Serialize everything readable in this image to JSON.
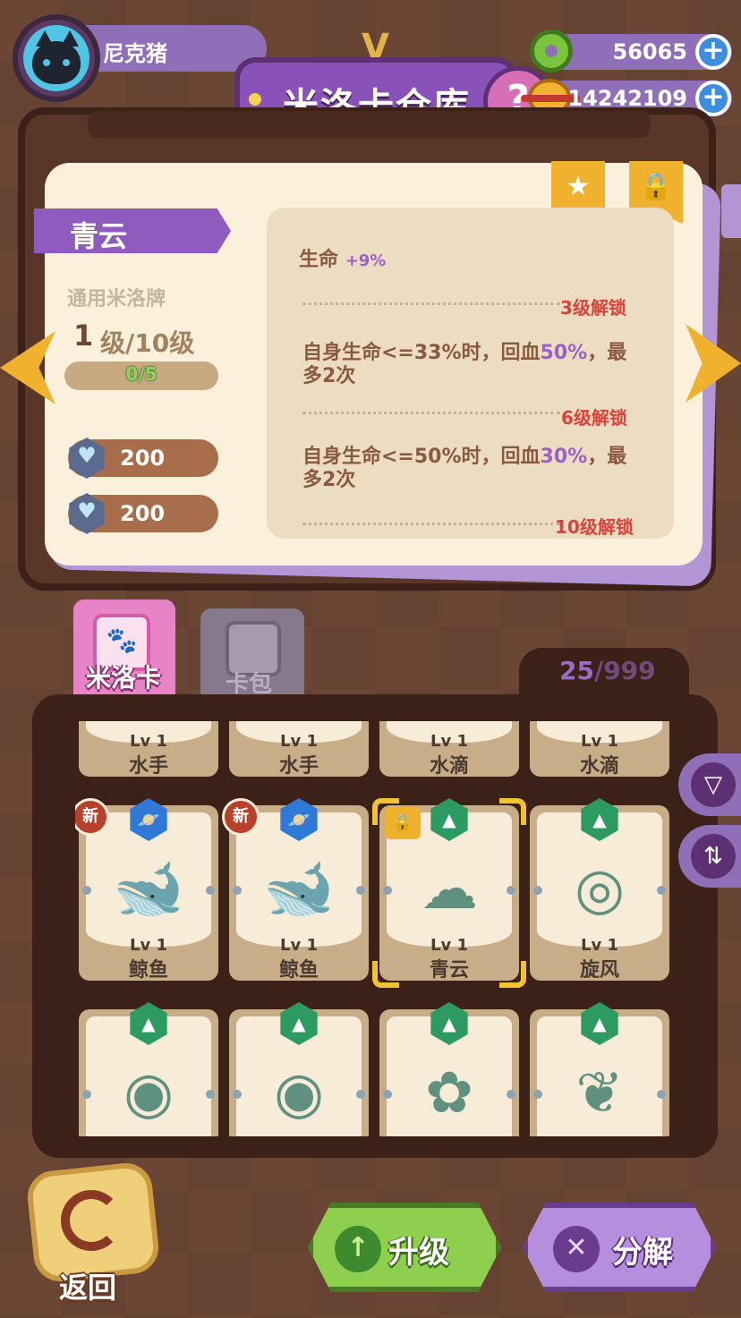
{
  "player": {
    "name": "尼克猪"
  },
  "header": {
    "title": "米洛卡仓库",
    "help": "?"
  },
  "currency": [
    {
      "icon": "donut-coin-icon",
      "value": "56065"
    },
    {
      "icon": "planet-coin-icon",
      "value": "14242109"
    }
  ],
  "detail": {
    "name": "青云",
    "card_type": "通用米洛牌",
    "level_current": "1",
    "level_text": "级/10级",
    "progress": "0/5",
    "progress_fraction": 0,
    "costs": [
      {
        "icon": "heart-gem-icon",
        "value": "200"
      },
      {
        "icon": "heart-gem-icon",
        "value": "200"
      }
    ],
    "attrs": {
      "a1_label": "生命",
      "a1_value": "+9%",
      "u1": "3级解锁",
      "a2_pre": "自身生命<=33%时，回血",
      "a2_pct": "50%",
      "a2_post": "，最多2次",
      "u2": "6级解锁",
      "a3_pre": "自身生命<=50%时，回血",
      "a3_pct": "30%",
      "a3_post": "，最多2次",
      "u3": "10级解锁"
    }
  },
  "tabs": {
    "milo": "米洛卡",
    "pack": "卡包"
  },
  "inventory": {
    "count": "25",
    "max": "/999"
  },
  "cards": [
    {
      "lv": "Lv 1",
      "name": "水手",
      "art": "⚓",
      "art_color": "#7a8ea6"
    },
    {
      "lv": "Lv 1",
      "name": "水手",
      "art": "⚓",
      "art_color": "#7a8ea6"
    },
    {
      "lv": "Lv 1",
      "name": "水滴",
      "art": "●",
      "art_color": "#8ea3b8"
    },
    {
      "lv": "Lv 1",
      "name": "水滴",
      "art": "●",
      "art_color": "#8ea3b8"
    },
    {
      "lv": "Lv 1",
      "name": "鲸鱼",
      "art": "🐋",
      "art_color": "#6f88a8",
      "rarity": "blue",
      "new": "新"
    },
    {
      "lv": "Lv 1",
      "name": "鲸鱼",
      "art": "🐋",
      "art_color": "#6f88a8",
      "rarity": "blue",
      "new": "新"
    },
    {
      "lv": "Lv 1",
      "name": "青云",
      "art": "☁",
      "art_color": "#5f9080",
      "rarity": "green",
      "locked": true,
      "selected": true
    },
    {
      "lv": "Lv 1",
      "name": "旋风",
      "art": "◎",
      "art_color": "#5f9080",
      "rarity": "green"
    },
    {
      "lv": "",
      "name": "",
      "art": "◉",
      "art_color": "#5f9080",
      "rarity": "green"
    },
    {
      "lv": "",
      "name": "",
      "art": "◉",
      "art_color": "#5f9080",
      "rarity": "green"
    },
    {
      "lv": "",
      "name": "",
      "art": "✿",
      "art_color": "#5f9080",
      "rarity": "green"
    },
    {
      "lv": "",
      "name": "",
      "art": "❦",
      "art_color": "#5f9080",
      "rarity": "green"
    }
  ],
  "buttons": {
    "back": "返回",
    "upgrade": "升级",
    "disassemble": "分解"
  }
}
